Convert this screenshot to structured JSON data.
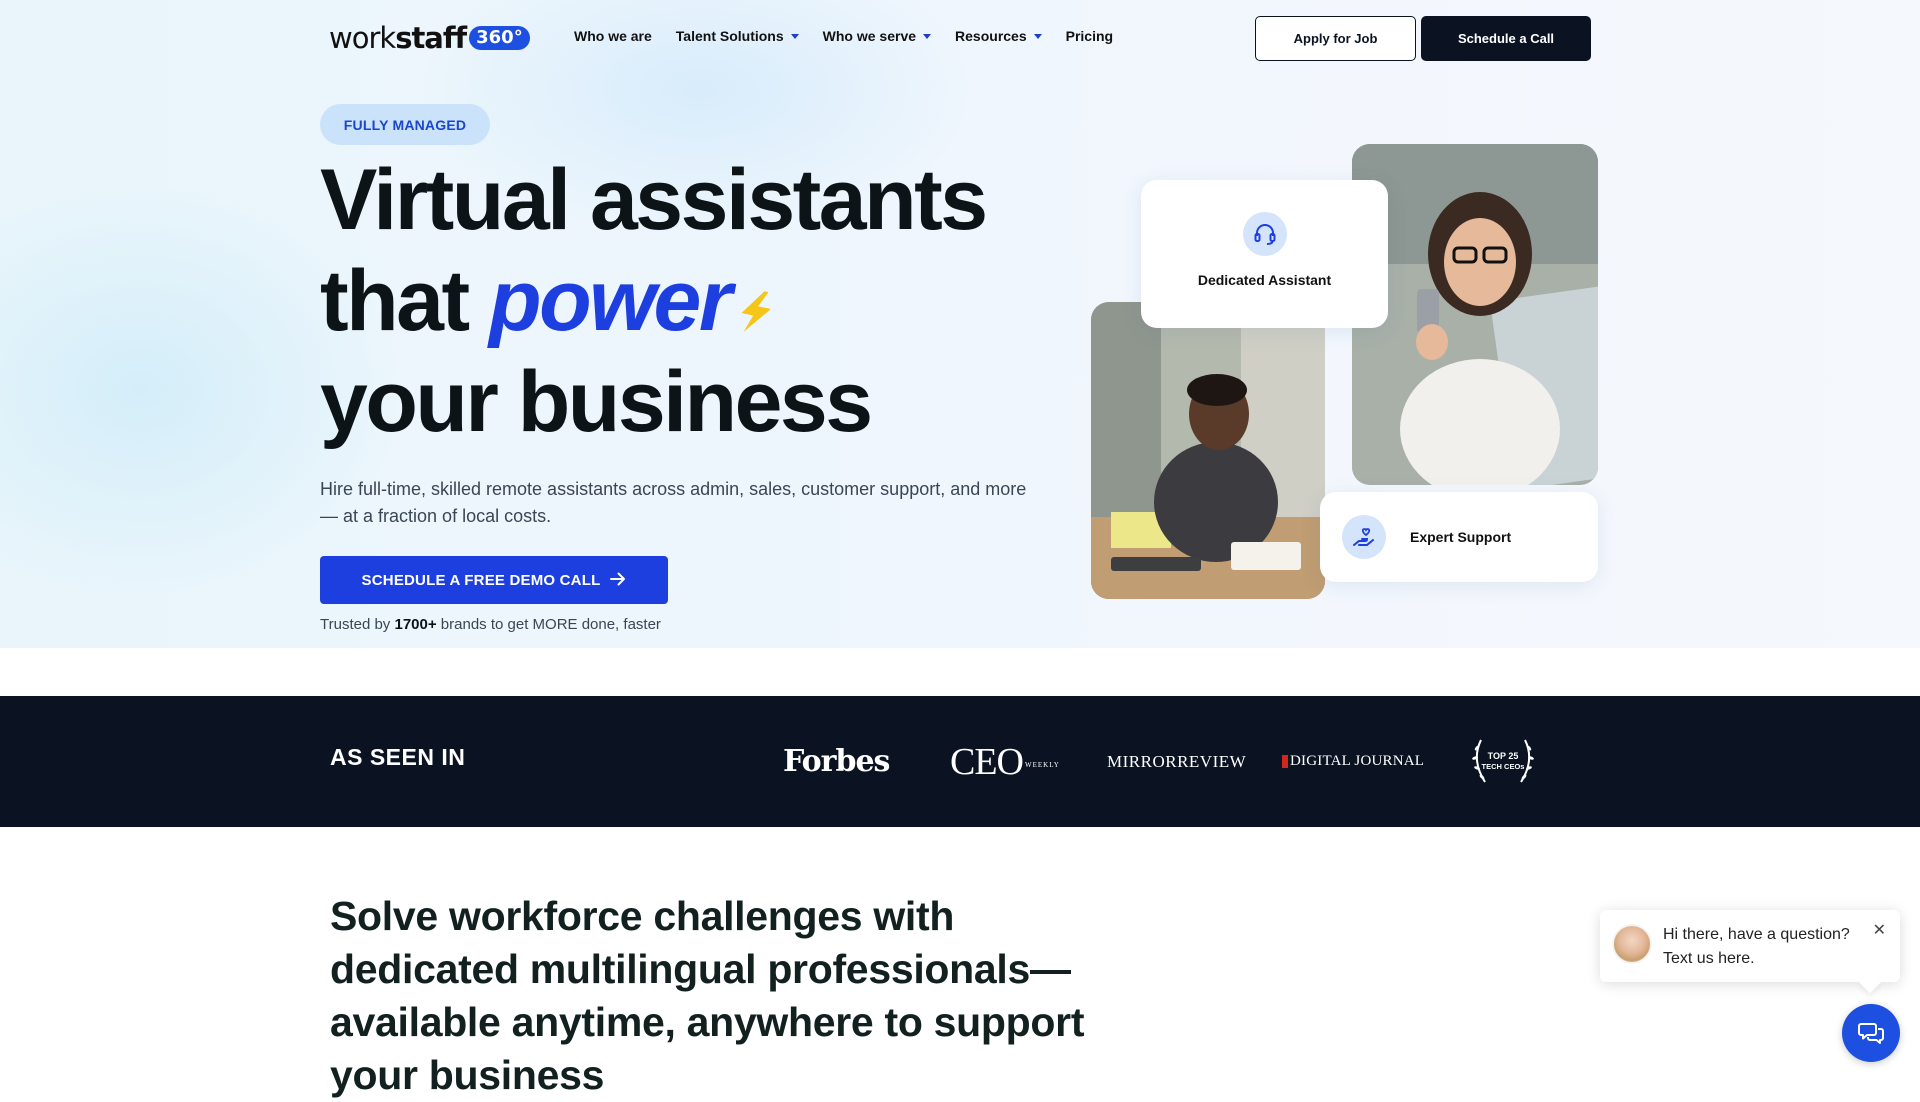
{
  "brand": {
    "name_light": "work",
    "name_bold": "staff",
    "badge": "360°"
  },
  "nav": {
    "items": [
      {
        "label": "Who we are",
        "dropdown": false
      },
      {
        "label": "Talent Solutions",
        "dropdown": true
      },
      {
        "label": "Who we serve",
        "dropdown": true
      },
      {
        "label": "Resources",
        "dropdown": true
      },
      {
        "label": "Pricing",
        "dropdown": false
      }
    ],
    "apply_label": "Apply for Job",
    "call_label": "Schedule a Call"
  },
  "hero": {
    "pill": "FULLY MANAGED",
    "headline_line1": "Virtual assistants",
    "headline_that": "that",
    "headline_power": "power",
    "headline_line3": "your business",
    "subtext": "Hire full-time, skilled remote assistants across admin, sales, customer support, and more — at a fraction of local costs.",
    "cta_label": "SCHEDULE A FREE DEMO CALL",
    "trusted_prefix": "Trusted by",
    "trusted_count": "1700+",
    "trusted_suffix": "brands to get MORE done, faster",
    "card_dedicated": "Dedicated Assistant",
    "card_expert": "Expert Support"
  },
  "press": {
    "title": "AS SEEN IN",
    "forbes": "Forbes",
    "ceo": "CEO",
    "ceo_small": "WEEKLY",
    "mirror": "MIRRORREVIEW",
    "digital_journal": "DIGITAL JOURNAL",
    "laurel_line1": "TOP 25",
    "laurel_line2": "TECH CEOs"
  },
  "section": {
    "heading": "Solve workforce challenges with dedicated multilingual professionals—available anytime, anywhere to support your business"
  },
  "chat": {
    "line1": "Hi there, have a question?",
    "line2": "Text us here.",
    "close": "✕"
  },
  "colors": {
    "accent": "#1d3fe0",
    "dark": "#0b1323",
    "pill_bg": "#cbe3fa",
    "bolt": "#f5c518"
  }
}
